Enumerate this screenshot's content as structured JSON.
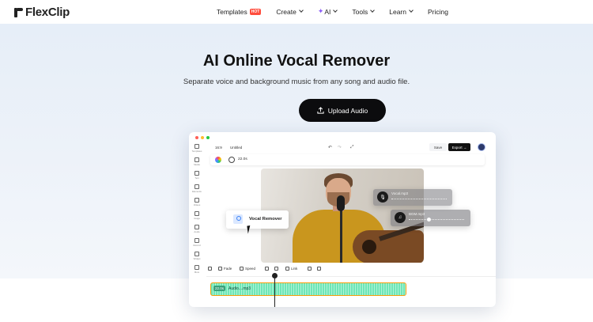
{
  "nav": {
    "logo": "FlexClip",
    "items": [
      {
        "label": "Templates",
        "badge": "HOT"
      },
      {
        "label": "Create"
      },
      {
        "label": "AI"
      },
      {
        "label": "Tools"
      },
      {
        "label": "Learn"
      },
      {
        "label": "Pricing"
      }
    ]
  },
  "hero": {
    "title": "AI Online Vocal Remover",
    "subtitle": "Separate voice and background music from any song and audio file.",
    "cta": "Upload Audio"
  },
  "editor": {
    "ratio": "16:9",
    "project_title": "Untitled",
    "save": "Save",
    "export": "Export",
    "duration": "22.0s",
    "sidebar": [
      "Templates",
      "Media",
      "Text",
      "Elements",
      "Videos",
      "Image",
      "Audio",
      "Record",
      "Widget",
      "More"
    ],
    "vocal_remover_label": "Vocal Remover",
    "vocal_file": "Vocal.mp3",
    "bgm_file": "BGM.mp3",
    "timeline_tools": [
      "Fade",
      "Speed",
      "Link"
    ],
    "track_duration": "22.0s",
    "track_name": "Audio....mp3"
  },
  "colors": {
    "accent": "#0c0c0e",
    "track": "#6ee7b7",
    "track_border": "#f59e0b",
    "hot_badge": "#ff4d3d"
  }
}
